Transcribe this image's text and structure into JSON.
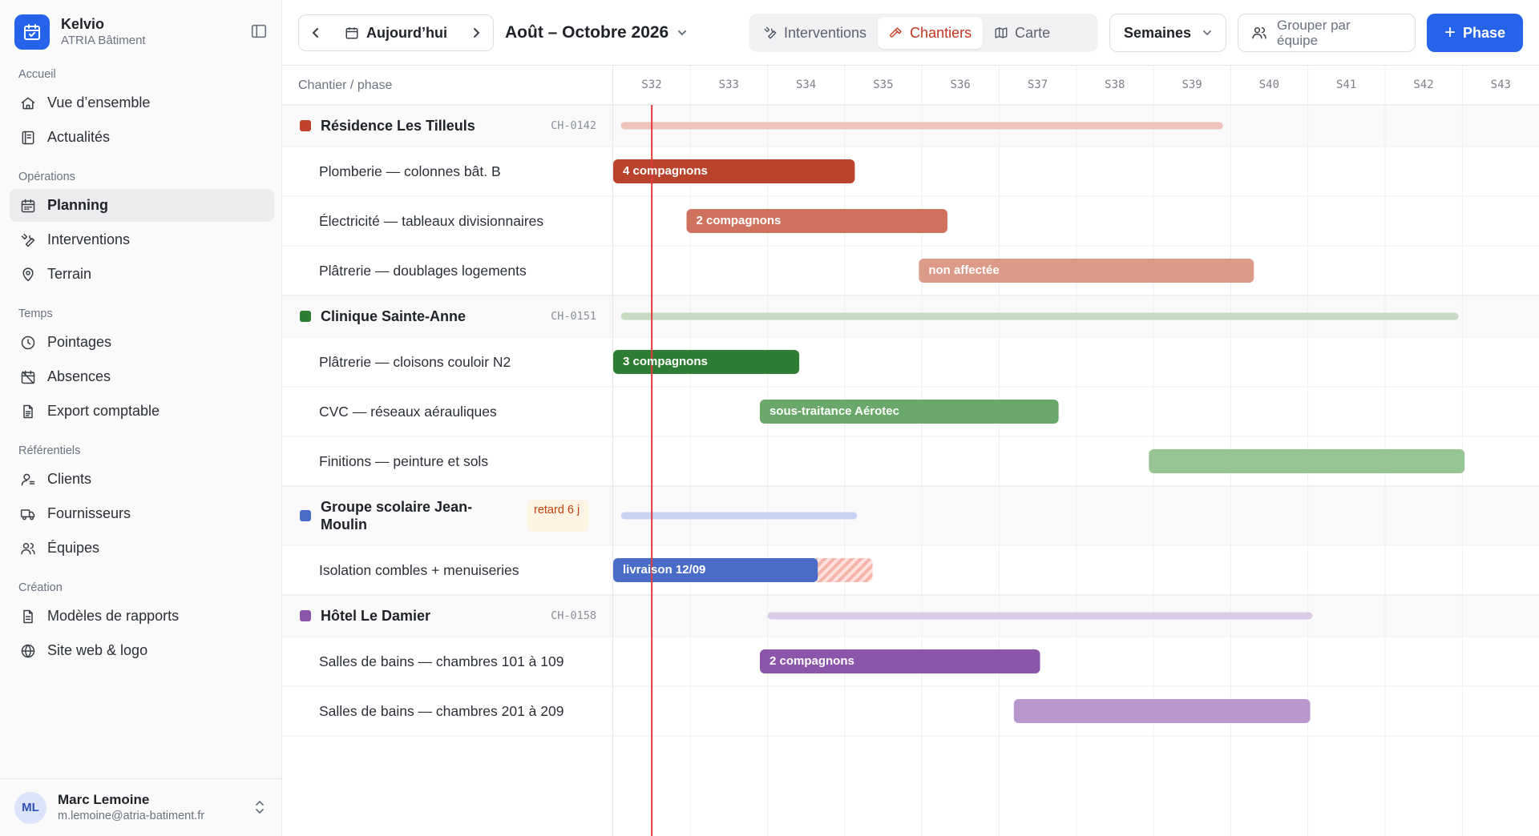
{
  "brand": {
    "name": "Kelvio",
    "company": "ATRIA Bâtiment"
  },
  "nav": [
    {
      "heading": "Accueil",
      "items": [
        {
          "label": "Vue d’ensemble",
          "icon": "home-icon"
        },
        {
          "label": "Actualités",
          "icon": "news-icon"
        }
      ]
    },
    {
      "heading": "Opérations",
      "items": [
        {
          "label": "Planning",
          "icon": "calendar-icon",
          "active": true
        },
        {
          "label": "Interventions",
          "icon": "wrench-icon"
        },
        {
          "label": "Terrain",
          "icon": "map-pin-icon"
        }
      ]
    },
    {
      "heading": "Temps",
      "items": [
        {
          "label": "Pointages",
          "icon": "clock-icon"
        },
        {
          "label": "Absences",
          "icon": "calendar-off-icon"
        },
        {
          "label": "Export comptable",
          "icon": "file-icon"
        }
      ]
    },
    {
      "heading": "Référentiels",
      "items": [
        {
          "label": "Clients",
          "icon": "user-icon"
        },
        {
          "label": "Fournisseurs",
          "icon": "truck-icon"
        },
        {
          "label": "Équipes",
          "icon": "users-icon"
        }
      ]
    },
    {
      "heading": "Création",
      "items": [
        {
          "label": "Modèles de rapports",
          "icon": "file-text-icon"
        },
        {
          "label": "Site web & logo",
          "icon": "globe-icon"
        }
      ]
    }
  ],
  "user": {
    "initials": "ML",
    "name": "Marc Lemoine",
    "email": "m.lemoine@atria-batiment.fr"
  },
  "toolbar": {
    "today_label": "Aujourd’hui",
    "range_label": "Août – Octobre 2026",
    "views": [
      {
        "label": "Interventions",
        "icon": "wrench-icon"
      },
      {
        "label": "Chantiers",
        "icon": "hammer-icon",
        "active": true
      },
      {
        "label": "Carte",
        "icon": "map-icon"
      }
    ],
    "scale_label": "Semaines",
    "group_label": "Grouper par équipe",
    "add_label": "Phase"
  },
  "gantt": {
    "label_header": "Chantier / phase",
    "weeks": [
      "S32",
      "S33",
      "S34",
      "S35",
      "S36",
      "S37",
      "S38",
      "S39",
      "S40",
      "S41",
      "S42",
      "S43"
    ],
    "today_week": 32.5,
    "rows": [
      {
        "kind": "group",
        "label": "Résidence Les Tilleuls",
        "code": "CH-0142",
        "color": "#c2412d",
        "summary_color": "#efc3ba",
        "start": 32.1,
        "end": 39.9
      },
      {
        "kind": "phase",
        "label": "Plomberie — colonnes bât. B",
        "bar_text": "4 compagnons",
        "color": "#b9432c",
        "start": 32.0,
        "end": 35.13
      },
      {
        "kind": "phase",
        "label": "Électricité — tableaux divisionnaires",
        "bar_text": "2 compagnons",
        "color": "#d0735e",
        "start": 32.95,
        "end": 36.33
      },
      {
        "kind": "phase",
        "label": "Plâtrerie — doublages logements",
        "bar_text": "non affectée",
        "color": "#dc9a89",
        "start": 35.96,
        "end": 40.3
      },
      {
        "kind": "group",
        "label": "Clinique Sainte-Anne",
        "code": "CH-0151",
        "color": "#2e7d32",
        "summary_color": "#c5dcc2",
        "start": 32.1,
        "end": 42.95
      },
      {
        "kind": "phase",
        "label": "Plâtrerie — cloisons couloir N2",
        "bar_text": "3 compagnons",
        "color": "#2e7d32",
        "start": 32.0,
        "end": 34.41
      },
      {
        "kind": "phase",
        "label": "CVC — réseaux aérauliques",
        "bar_text": "sous-traitance Aérotec",
        "color": "#69a76b",
        "start": 33.9,
        "end": 37.77
      },
      {
        "kind": "phase",
        "label": "Finitions — peinture et sols",
        "bar_text": "",
        "color": "#96c494",
        "start": 38.94,
        "end": 43.03
      },
      {
        "kind": "group",
        "label": "Groupe scolaire Jean-Moulin",
        "badge": "retard 6 j",
        "color": "#4a6cc9",
        "summary_color": "#c8d3f3",
        "start": 32.1,
        "end": 35.16
      },
      {
        "kind": "phase",
        "label": "Isolation combles + menuiseries",
        "bar_text": "livraison 12/09",
        "color": "#4a6cc9",
        "start": 32.0,
        "end": 34.65,
        "delay_end": 35.36
      },
      {
        "kind": "group",
        "label": "Hôtel Le Damier",
        "code": "CH-0158",
        "color": "#8b55aa",
        "summary_color": "#dccbe7",
        "start": 34.0,
        "end": 41.06
      },
      {
        "kind": "phase",
        "label": "Salles de bains — chambres 101 à 109",
        "bar_text": "2 compagnons",
        "color": "#8b55aa",
        "start": 33.9,
        "end": 37.53
      },
      {
        "kind": "phase",
        "label": "Salles de bains — chambres 201 à 209",
        "bar_text": "",
        "color": "#b897cf",
        "start": 37.19,
        "end": 41.03
      }
    ]
  }
}
